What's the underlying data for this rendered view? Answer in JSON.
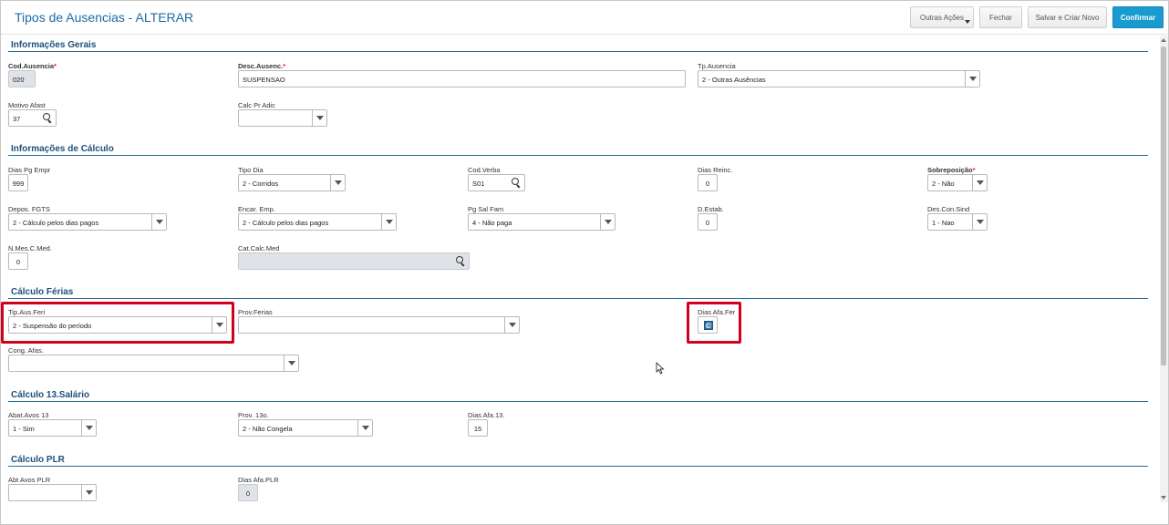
{
  "header": {
    "title": "Tipos de Ausencias - ALTERAR",
    "buttons": {
      "outras_acoes": "Outras Ações",
      "fechar": "Fechar",
      "salvar_criar": "Salvar e Criar Novo",
      "confirmar": "Confirmar"
    }
  },
  "sections": {
    "gerais": "Informações Gerais",
    "calculo": "Informações de Cálculo",
    "ferias": "Cálculo Férias",
    "salario13": "Cálculo 13.Salário",
    "plr": "Cálculo PLR"
  },
  "fields": {
    "cod_ausencia": {
      "label": "Cod.Ausencia",
      "required": "*",
      "value": "020"
    },
    "desc_ausenc": {
      "label": "Desc.Ausenc.",
      "required": "*",
      "value": "SUSPENSAO"
    },
    "tp_ausencia": {
      "label": "Tp.Ausencia",
      "value": "2 - Outras Ausências"
    },
    "motivo_afast": {
      "label": "Motivo Afast",
      "value": "37"
    },
    "calc_pr_adic": {
      "label": "Calc Pr Adic",
      "value": ""
    },
    "dias_pg_empr": {
      "label": "Dias Pg Empr",
      "value": "999"
    },
    "tipo_dia": {
      "label": "Tipo Dia",
      "value": "2 - Corridos"
    },
    "cod_verba": {
      "label": "Cod.Verba",
      "value": "S01"
    },
    "dias_reinc": {
      "label": "Dias Reinc.",
      "value": "0"
    },
    "sobreposicao": {
      "label": "Sobreposição",
      "required": "*",
      "value": "2 - Não"
    },
    "depos_fgts": {
      "label": "Depos. FGTS",
      "value": "2 - Cálculo pelos dias pagos"
    },
    "encar_emp": {
      "label": "Encar. Emp.",
      "value": "2 - Cálculo pelos dias pagos"
    },
    "pg_sal_fam": {
      "label": "Pg Sal Fam",
      "value": "4 - Não paga"
    },
    "d_estab": {
      "label": "D.Estab.",
      "value": "0"
    },
    "des_con_sind": {
      "label": "Des.Con.Sind",
      "value": "1 - Nao"
    },
    "n_mes_c_med": {
      "label": "N.Mes.C.Med.",
      "value": "0"
    },
    "cat_calc_med": {
      "label": "Cat.Calc.Med",
      "value": ""
    },
    "tip_aus_feri": {
      "label": "Tip.Aus.Feri",
      "value": "2 - Suspensão do período"
    },
    "prov_ferias": {
      "label": "Prov.Ferias",
      "value": ""
    },
    "dias_afa_fer": {
      "label": "Dias Afa.Fer",
      "value": "0"
    },
    "cong_afas": {
      "label": "Cong. Afas.",
      "value": ""
    },
    "abat_avos_13": {
      "label": "Abat.Avos 13",
      "value": "1 - Sim"
    },
    "prov_13o": {
      "label": "Prov. 13o.",
      "value": "2 - Não Congela"
    },
    "dias_afa_13": {
      "label": "Dias Afa.13.",
      "value": "15"
    },
    "abt_avos_plr": {
      "label": "Abt Avos PLR",
      "value": ""
    },
    "dias_afa_plr": {
      "label": "Dias Afa.PLR",
      "value": "0"
    }
  },
  "colors": {
    "title": "#1d6ba2",
    "primary_button": "#1a9bcf",
    "section_line": "#2b6c95",
    "highlight": "#d0021b",
    "required": "#d9232a"
  }
}
